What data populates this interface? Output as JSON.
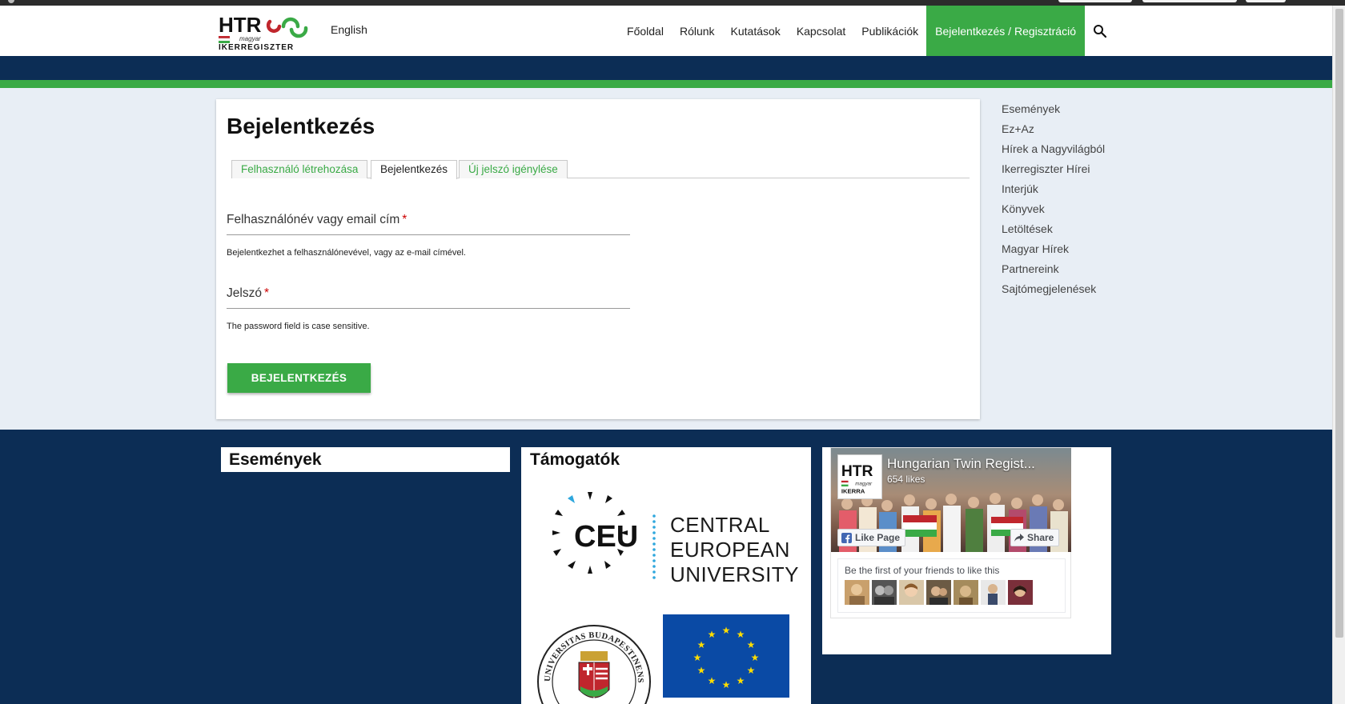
{
  "header": {
    "logo_text": "HTR",
    "logo_sub1": "magyar",
    "logo_sub2": "IKERREGISZTER",
    "language": "English",
    "nav": [
      "Főoldal",
      "Rólunk",
      "Kutatások",
      "Kapcsolat",
      "Publikációk"
    ],
    "nav_active": "Bejelentkezés / Regisztráció",
    "search_icon": "search-icon"
  },
  "login": {
    "title": "Bejelentkezés",
    "tabs": [
      "Felhasználó létrehozása",
      "Bejelentkezés",
      "Új jelszó igénylése"
    ],
    "active_tab": 1,
    "username_label": "Felhasználónév vagy email cím",
    "username_help": "Bejelentkezhet a felhasználónevével, vagy az e-mail címével.",
    "username_value": "",
    "password_label": "Jelszó",
    "password_help": "The password field is case sensitive.",
    "password_value": "",
    "required_mark": "*",
    "submit_label": "BEJELENTKEZÉS"
  },
  "sidebar": {
    "items": [
      "Események",
      "Ez+Az",
      "Hírek a Nagyvilágból",
      "Ikerregiszter Hírei",
      "Interjúk",
      "Könyvek",
      "Letöltések",
      "Magyar Hírek",
      "Partnereink",
      "Sajtómegjelenések"
    ]
  },
  "footer": {
    "events_title": "Események",
    "sponsors_title": "Támogatók",
    "ceu_abbr": "CEU",
    "ceu_line1": "CENTRAL",
    "ceu_line2": "EUROPEAN",
    "ceu_line3": "UNIVERSITY",
    "seal_text": "UNIVERSITAS BUDAPESTINENSIS DE SEMMELWEIS NOMINATA",
    "facebook": {
      "page_name": "Hungarian Twin Regist...",
      "likes": "654 likes",
      "like_button": "Like Page",
      "share_button": "Share",
      "friends_text": "Be the first of your friends to like this",
      "logo_text": "HTR",
      "logo_sub1": "magyar",
      "logo_sub2": "IKERRA"
    }
  },
  "colors": {
    "accent_green": "#3aaa46",
    "navy": "#0c2d55",
    "page_bg": "#e8eef5",
    "required_red": "#cc0000",
    "eu_blue": "#0a4aa5",
    "eu_star": "#ffdd00"
  }
}
